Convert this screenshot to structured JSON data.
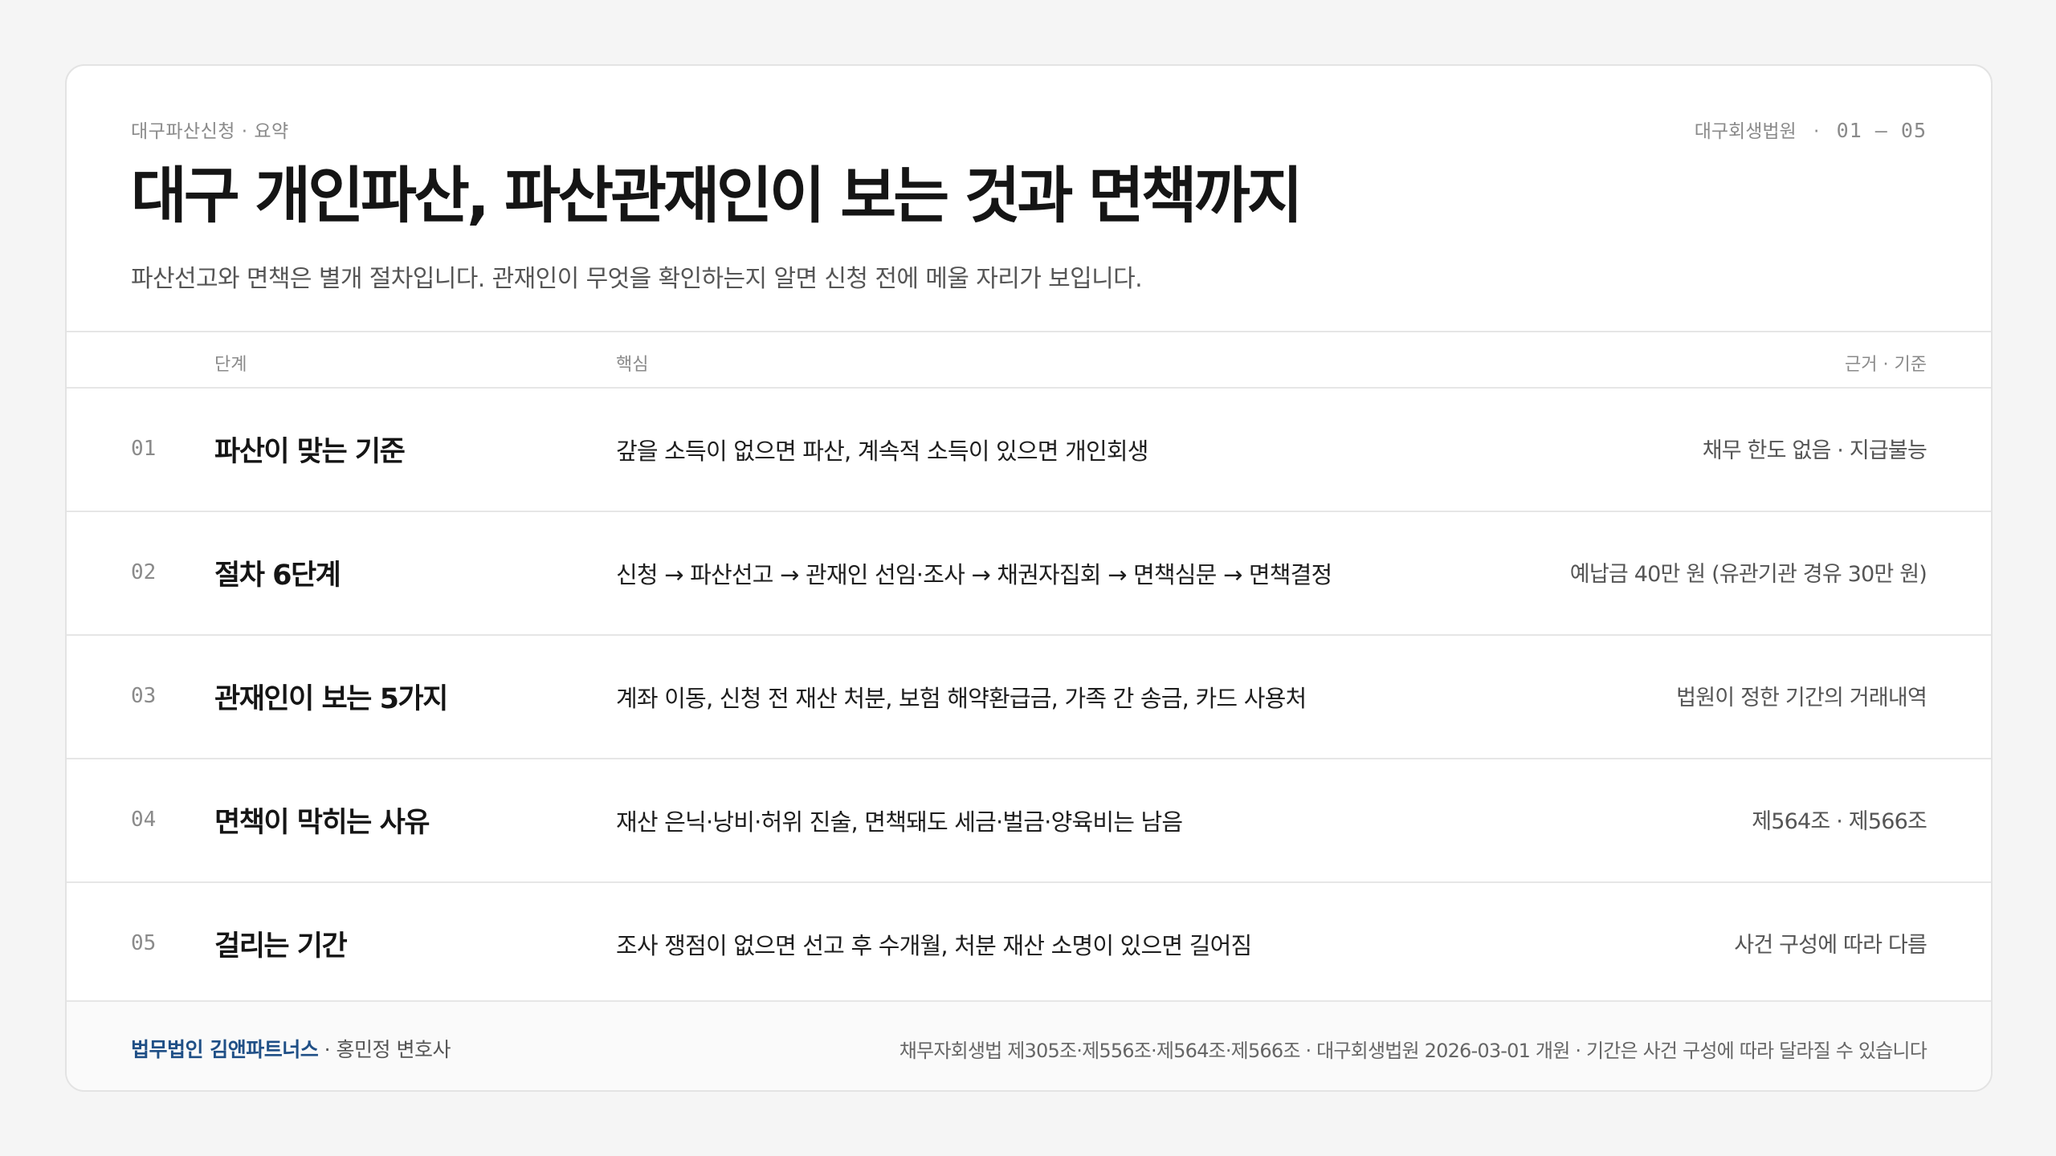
{
  "header": {
    "eyebrow": "대구파산신청 · 요약",
    "court": "대구회생법원",
    "separator": "·",
    "page_range": "01 — 05",
    "title": "대구 개인파산, 파산관재인이 보는 것과 면책까지",
    "subtitle": "파산선고와 면책은 별개 절차입니다. 관재인이 무엇을 확인하는지 알면 신청 전에 메울 자리가 보입니다."
  },
  "table": {
    "columns": {
      "step": "단계",
      "core": "핵심",
      "basis": "근거 · 기준"
    },
    "rows": [
      {
        "num": "01",
        "name": "파산이 맞는 기준",
        "core": "갚을 소득이 없으면 파산, 계속적 소득이 있으면 개인회생",
        "basis": "채무 한도 없음 · 지급불능"
      },
      {
        "num": "02",
        "name": "절차 6단계",
        "core": "신청 → 파산선고 → 관재인 선임·조사 → 채권자집회 → 면책심문 → 면책결정",
        "basis": "예납금 40만 원 (유관기관 경유 30만 원)"
      },
      {
        "num": "03",
        "name": "관재인이 보는 5가지",
        "core": "계좌 이동, 신청 전 재산 처분, 보험 해약환급금, 가족 간 송금, 카드 사용처",
        "basis": "법원이 정한 기간의 거래내역"
      },
      {
        "num": "04",
        "name": "면책이 막히는 사유",
        "core": "재산 은닉·낭비·허위 진술, 면책돼도 세금·벌금·양육비는 남음",
        "basis": "제564조 · 제566조"
      },
      {
        "num": "05",
        "name": "걸리는 기간",
        "core": "조사 쟁점이 없으면 선고 후 수개월, 처분 재산 소명이 있으면 길어짐",
        "basis": "사건 구성에 따라 다름"
      }
    ]
  },
  "footer": {
    "firm": "법무법인 김앤파트너스",
    "lawyer": " · 홍민정 변호사",
    "note": "채무자회생법 제305조·제556조·제564조·제566조 · 대구회생법원 2026-03-01 개원 · 기간은 사건 구성에 따라 달라질 수 있습니다"
  }
}
